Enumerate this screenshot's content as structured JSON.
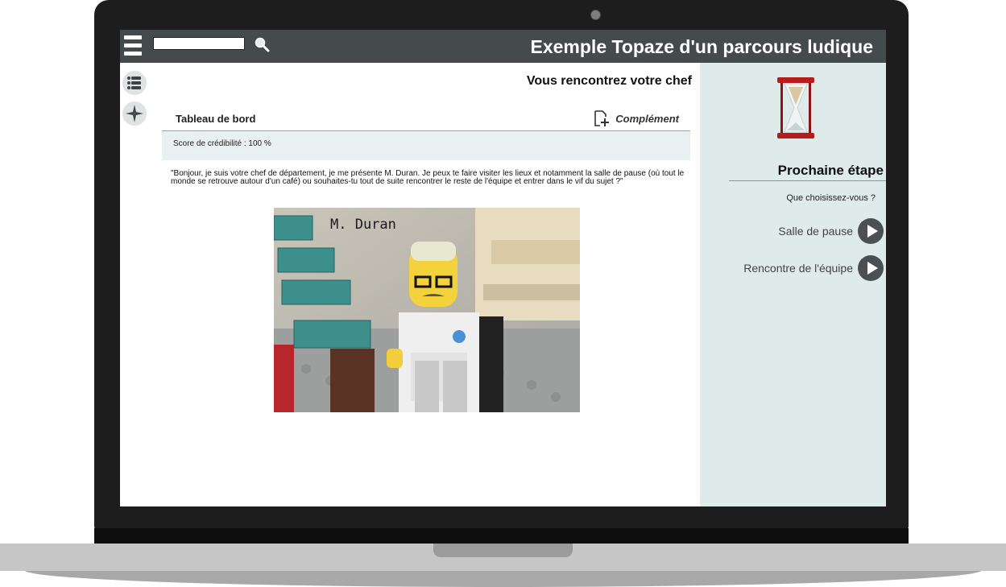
{
  "header": {
    "app_title": "Exemple Topaze d'un parcours ludique",
    "search_value": "",
    "menu_icon": "hamburger-icon",
    "search_icon": "magnifier-icon"
  },
  "sidebar_left": {
    "buttons": [
      {
        "icon": "list-icon"
      },
      {
        "icon": "compass-icon"
      }
    ]
  },
  "main": {
    "scene_title": "Vous rencontrez votre chef",
    "dashboard": {
      "title": "Tableau de bord",
      "complement_label": "Complément",
      "complement_icon": "add-document-icon",
      "score_text": "Score de crédibilité : 100 %"
    },
    "dialogue": "\"Bonjour, je suis votre chef de département, je me présente M. Duran. Je peux te faire visiter les lieux et notamment la salle de pause (où tout le monde se retrouve autour d'un café) ou souhaites-tu tout de suite rencontrer le reste de l'équipe et entrer dans le vif du sujet ?\"",
    "image_caption": "M. Duran"
  },
  "right_panel": {
    "icon": "hourglass-icon",
    "next_step_title": "Prochaine étape",
    "question": "Que choisissez-vous ?",
    "choices": [
      {
        "label": "Salle de pause"
      },
      {
        "label": "Rencontre de l'équipe"
      }
    ]
  },
  "colors": {
    "topbar": "#454b4d",
    "right_panel_bg": "#dfeaeb",
    "dashboard_bg": "#e9f0f1",
    "play_button": "#4b5153"
  }
}
